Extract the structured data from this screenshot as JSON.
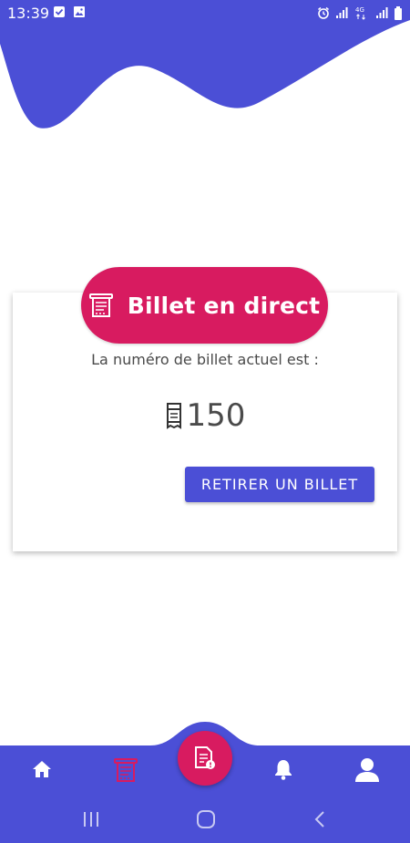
{
  "status_bar": {
    "time": "13:39",
    "left_icons": [
      "checkbox-icon",
      "image-icon"
    ],
    "right_icons": [
      "alarm-icon",
      "signal-icon",
      "network-4g-icon",
      "signal-icon",
      "battery-icon"
    ],
    "network_label": "4G"
  },
  "colors": {
    "primary": "#4b4fd6",
    "accent": "#d81b60",
    "text": "#4a4a4a",
    "background": "#ffffff"
  },
  "card": {
    "title": "Billet en direct",
    "title_icon": "ticket-machine-icon",
    "subtitle": "La numéro de billet actuel est :",
    "ticket_icon": "receipt-icon",
    "ticket_number": "150",
    "action_label": "RETIRER UN BILLET"
  },
  "bottom_nav": {
    "items": [
      {
        "icon": "home-icon"
      },
      {
        "icon": "ticket-machine-icon",
        "active": true
      },
      {
        "icon": "report-icon"
      },
      {
        "icon": "bell-icon"
      },
      {
        "icon": "user-icon"
      }
    ]
  },
  "system_nav": [
    "recents-icon",
    "home-circle-icon",
    "back-icon"
  ]
}
